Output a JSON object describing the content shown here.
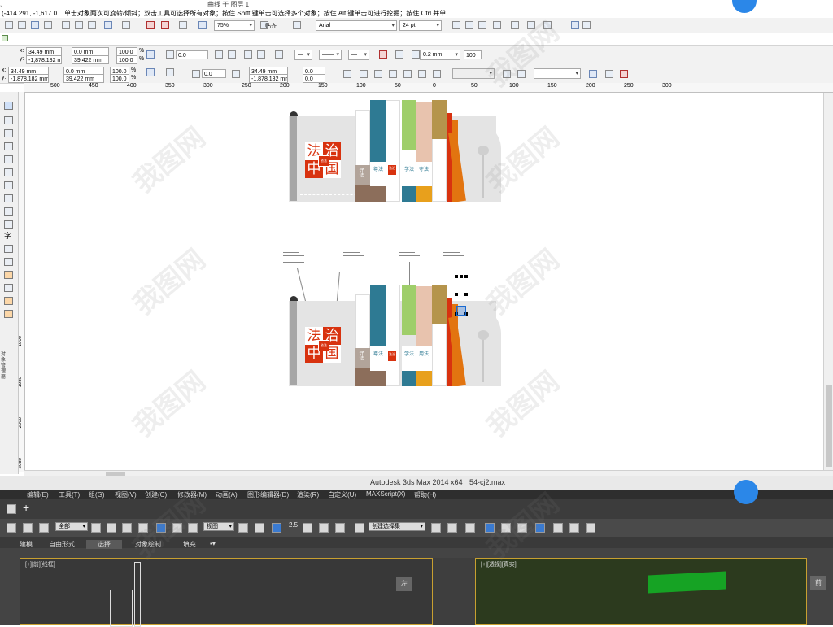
{
  "corel": {
    "status_hint": "(-414.291, -1,617.0... 单击对象两次可旋转/倾斜；双击工具可选择所有对象；按住 Shift 键单击可选择多个对象；按住 Alt 键单击可进行挖掘；按住 Ctrl 并单...",
    "top_title_fragment": "曲线 于 图层 1",
    "zoom": "75%",
    "snap_label": "贴齐",
    "font_name": "Arial",
    "font_size": "24 pt",
    "prop1": {
      "x_label": "x:",
      "x": "34.49 mm",
      "y_label": "y:",
      "y": "-1,878.182 mm",
      "w": "0.0 mm",
      "h": "39.422 mm",
      "sx": "100.0",
      "sy": "100.0",
      "pct": "%",
      "rotate": "0.0",
      "outline_width": "0.2 mm",
      "outline_pct": "100"
    },
    "prop2": {
      "x_label": "x:",
      "x": "34.49 mm",
      "y_label": "y:",
      "y": "-1,878.182 mm",
      "w": "0.0 mm",
      "h": "39.422 mm",
      "sx": "100.0",
      "sy": "100.0",
      "pct": "%",
      "rotate": "0.0",
      "x2": "34.49 mm",
      "y2": "-1,878.182 mm",
      "off1": "0.0",
      "off2": "0.0"
    },
    "ruler_h": [
      "500",
      "450",
      "400",
      "350",
      "300",
      "250",
      "200",
      "150",
      "100",
      "50",
      "0",
      "50",
      "100",
      "150",
      "200",
      "250",
      "300"
    ],
    "ruler_v": [
      "1900",
      "1950",
      "2000",
      "2050"
    ],
    "side_tab": "对象管理器"
  },
  "design": {
    "title_chars": [
      "法",
      "治",
      "中",
      "国"
    ],
    "seal_text": "依法",
    "book_labels": [
      "守法",
      "尊法",
      "学法",
      "守法",
      "用法"
    ],
    "book_tag": "法治",
    "book_small_text": "全面依法治国",
    "colors": {
      "teal": "#2e7a93",
      "green": "#9fce6a",
      "peach": "#e8c3ae",
      "olive": "#b5944c",
      "red": "#d8320f",
      "orange": "#e27410",
      "brown": "#8c6e5b",
      "amber": "#e8a01c",
      "gray": "#d2d2d2"
    }
  },
  "window_title": "Autodesk 3ds Max  2014 x64",
  "window_file": "54-cj2.max",
  "max": {
    "menu": [
      "编辑(E)",
      "工具(T)",
      "组(G)",
      "视图(V)",
      "创建(C)",
      "修改器(M)",
      "动画(A)",
      "图形编辑器(D)",
      "渲染(R)",
      "自定义(U)",
      "MAXScript(X)",
      "帮助(H)"
    ],
    "select_all": "全部",
    "view_sel": "视图",
    "named_sel": "创建选择集",
    "snap_num": "2.5",
    "tabs": [
      "建模",
      "自由形式",
      "选择",
      "对象绘制",
      "填充"
    ],
    "vp_left": "[+][前][线框]",
    "vp_right": "[+][透视][真实]",
    "vp_cube_left": "左",
    "vp_cube_right": "前"
  },
  "watermark": "我图网"
}
